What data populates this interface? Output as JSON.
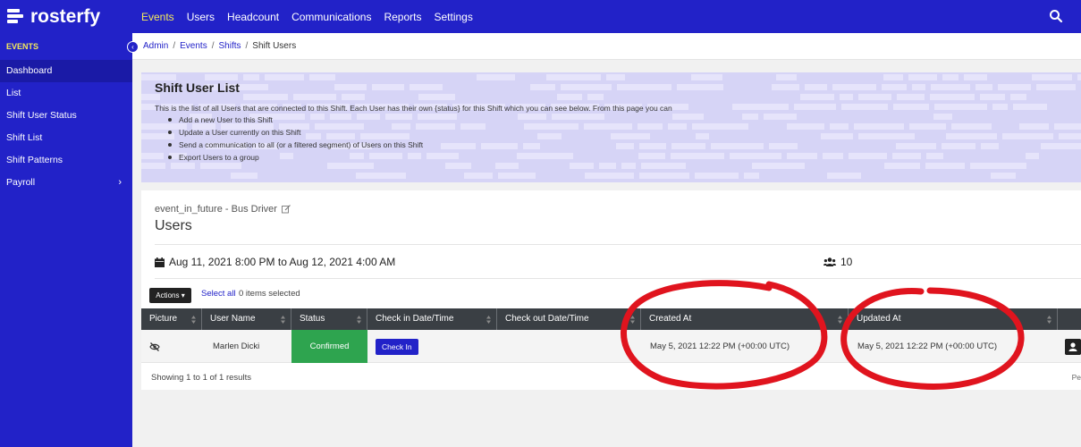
{
  "app": {
    "logo_text": "rosterfy"
  },
  "topnav": {
    "items": [
      {
        "label": "Events",
        "active": true
      },
      {
        "label": "Users",
        "active": false
      },
      {
        "label": "Headcount",
        "active": false
      },
      {
        "label": "Communications",
        "active": false
      },
      {
        "label": "Reports",
        "active": false
      },
      {
        "label": "Settings",
        "active": false
      }
    ],
    "search_icon": "search-icon"
  },
  "sidebar": {
    "section": "EVENTS",
    "items": [
      {
        "label": "Dashboard",
        "active": true
      },
      {
        "label": "List",
        "active": false
      },
      {
        "label": "Shift User Status",
        "active": false
      },
      {
        "label": "Shift List",
        "active": false
      },
      {
        "label": "Shift Patterns",
        "active": false
      },
      {
        "label": "Payroll",
        "active": false,
        "has_submenu": true
      }
    ]
  },
  "breadcrumb": {
    "items": [
      "Admin",
      "Events",
      "Shifts",
      "Shift Users"
    ],
    "separator": "/"
  },
  "info": {
    "title": "Shift User List",
    "description": "This is the list of all Users that are connected to this Shift. Each User has their own {status} for this Shift which you can see below. From this page you can",
    "bullets": [
      "Add a new User to this Shift",
      "Update a User currently on this Shift",
      "Send a communication to all (or a filtered segment) of Users on this Shift",
      "Export Users to a group"
    ]
  },
  "card": {
    "event_name": "event_in_future - Bus Driver",
    "title": "Users",
    "date_range": "Aug 11, 2021 8:00 PM to Aug 12, 2021 4:00 AM",
    "user_count": "10",
    "actions_label": "Actions",
    "select_all_label": "Select all",
    "selected_text": "0 items selected",
    "footer_text": "Showing 1 to 1 of 1 results",
    "per_page_text": "Pe"
  },
  "table": {
    "columns": [
      "Picture",
      "User Name",
      "Status",
      "Check in Date/Time",
      "Check out Date/Time",
      "Created At",
      "Updated At"
    ],
    "rows": [
      {
        "user_name": "Marlen Dicki",
        "status": "Confirmed",
        "checkin_button": "Check In",
        "checkout": "",
        "created_at": "May 5, 2021 12:22 PM (+00:00 UTC)",
        "updated_at": "May 5, 2021 12:22 PM (+00:00 UTC)"
      }
    ]
  },
  "colors": {
    "brand": "#2222c8",
    "active_nav": "#f3e95c",
    "status_confirmed": "#2ea44f",
    "annotation": "#e0141e"
  }
}
